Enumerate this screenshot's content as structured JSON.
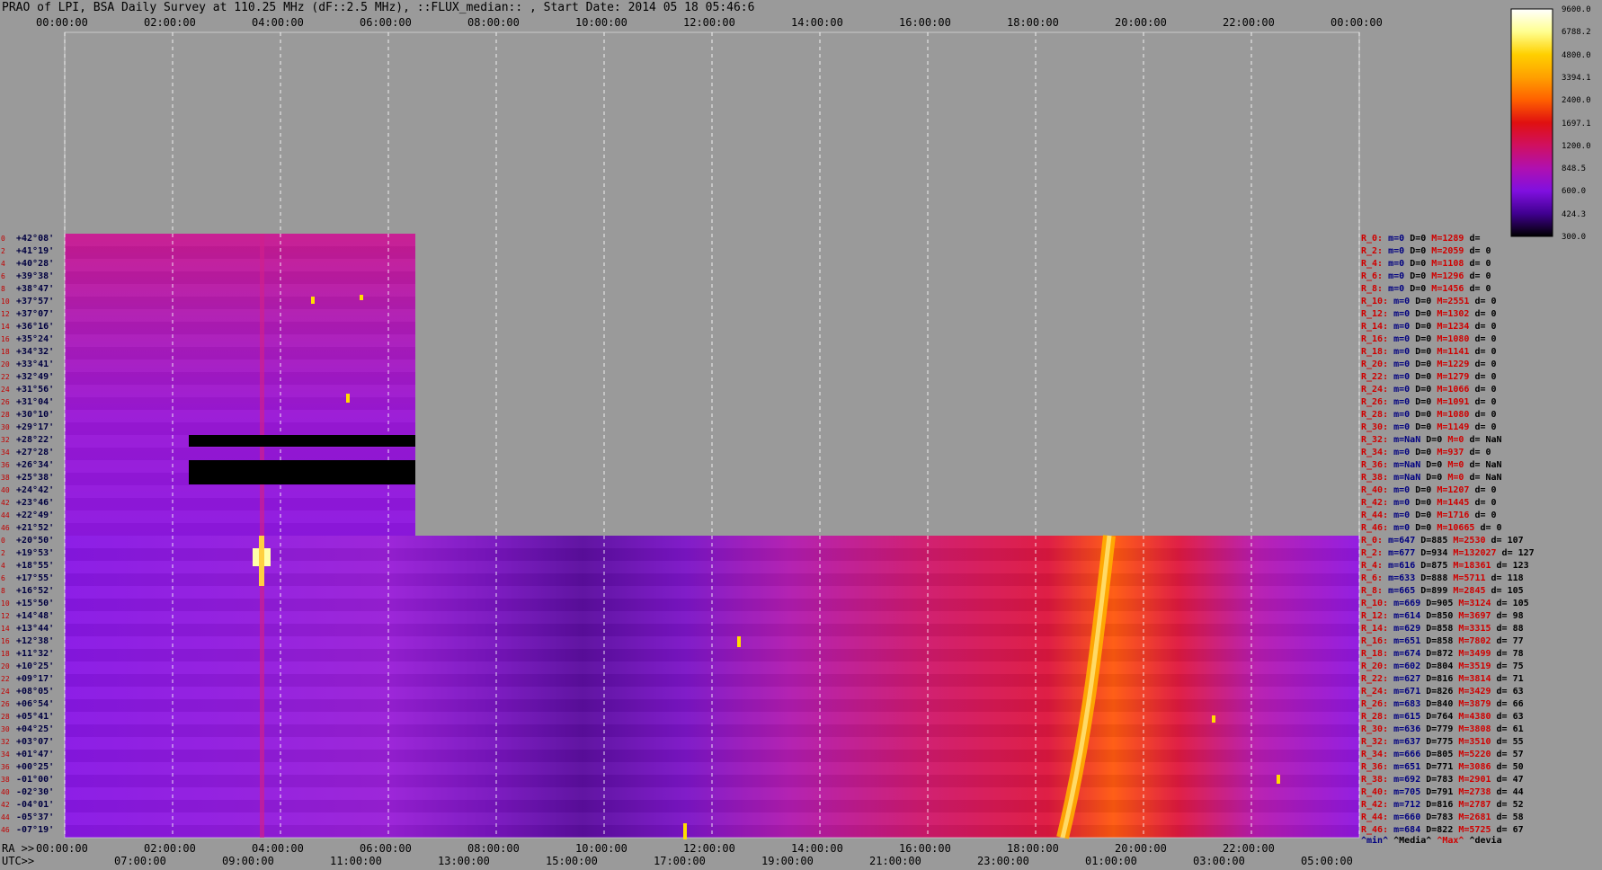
{
  "title": "PRAO of LPI, BSA Daily Survey at 110.25 MHz (dF::2.5 MHz), ::FLUX_median:: , Start Date: 2014 05 18 05:46:6",
  "bottom_axis": {
    "ra_prefix": "RA >>",
    "utc_prefix": "UTC>>"
  },
  "colorbar": {
    "tick_labels": [
      "9600.0",
      "6788.2",
      "4800.0",
      "3394.1",
      "2400.0",
      "1697.1",
      "1200.0",
      "848.5",
      "600.0",
      "424.3",
      "300.0"
    ],
    "colors": [
      "#ffffff",
      "#ffff90",
      "#ffd000",
      "#ffa000",
      "#ff6000",
      "#e01010",
      "#d01060",
      "#b010b0",
      "#8010e0",
      "#400090",
      "#000000"
    ]
  },
  "stats_footer": {
    "min": "^min^",
    "media": "^Media^",
    "max": "^Max^",
    "devia": "^devia"
  },
  "chart_data": {
    "type": "heatmap",
    "title": "PRAO of LPI, BSA Daily Survey at 110.25 MHz (dF::2.5 MHz), ::FLUX_median:: , Start Date: 2014 05 18 05:46:6",
    "x_top_ticks": [
      "00:00:00",
      "02:00:00",
      "04:00:00",
      "06:00:00",
      "08:00:00",
      "10:00:00",
      "12:00:00",
      "14:00:00",
      "16:00:00",
      "18:00:00",
      "20:00:00",
      "22:00:00",
      "00:00:00"
    ],
    "x_ra_ticks": [
      "00:00:00",
      "02:00:00",
      "04:00:00",
      "06:00:00",
      "08:00:00",
      "10:00:00",
      "12:00:00",
      "14:00:00",
      "16:00:00",
      "18:00:00",
      "20:00:00",
      "22:00:00"
    ],
    "x_utc_ticks": [
      "07:00:00",
      "09:00:00",
      "11:00:00",
      "13:00:00",
      "15:00:00",
      "17:00:00",
      "19:00:00",
      "21:00:00",
      "23:00:00",
      "01:00:00",
      "03:00:00",
      "05:00:00"
    ],
    "colorbar_scale": "log",
    "colorbar_range": [
      300.0,
      9600.0
    ],
    "upper_block": {
      "ra_range": [
        "00:00:00",
        "06:30:00"
      ],
      "rows": [
        {
          "idx": "0",
          "dec": "+42°08'",
          "stat": {
            "name": "R_0:",
            "m": "m=0",
            "D": "D=0",
            "M": "M=1289",
            "d": "d="
          }
        },
        {
          "idx": "2",
          "dec": "+41°19'",
          "stat": {
            "name": "R_2:",
            "m": "m=0",
            "D": "D=0",
            "M": "M=2059",
            "d": "d= 0"
          }
        },
        {
          "idx": "4",
          "dec": "+40°28'",
          "stat": {
            "name": "R_4:",
            "m": "m=0",
            "D": "D=0",
            "M": "M=1108",
            "d": "d= 0"
          }
        },
        {
          "idx": "6",
          "dec": "+39°38'",
          "stat": {
            "name": "R_6:",
            "m": "m=0",
            "D": "D=0",
            "M": "M=1296",
            "d": "d= 0"
          }
        },
        {
          "idx": "8",
          "dec": "+38°47'",
          "stat": {
            "name": "R_8:",
            "m": "m=0",
            "D": "D=0",
            "M": "M=1456",
            "d": "d= 0"
          }
        },
        {
          "idx": "10",
          "dec": "+37°57'",
          "stat": {
            "name": "R_10:",
            "m": "m=0",
            "D": "D=0",
            "M": "M=2551",
            "d": "d= 0"
          }
        },
        {
          "idx": "12",
          "dec": "+37°07'",
          "stat": {
            "name": "R_12:",
            "m": "m=0",
            "D": "D=0",
            "M": "M=1302",
            "d": "d= 0"
          }
        },
        {
          "idx": "14",
          "dec": "+36°16'",
          "stat": {
            "name": "R_14:",
            "m": "m=0",
            "D": "D=0",
            "M": "M=1234",
            "d": "d= 0"
          }
        },
        {
          "idx": "16",
          "dec": "+35°24'",
          "stat": {
            "name": "R_16:",
            "m": "m=0",
            "D": "D=0",
            "M": "M=1080",
            "d": "d= 0"
          }
        },
        {
          "idx": "18",
          "dec": "+34°32'",
          "stat": {
            "name": "R_18:",
            "m": "m=0",
            "D": "D=0",
            "M": "M=1141",
            "d": "d= 0"
          }
        },
        {
          "idx": "20",
          "dec": "+33°41'",
          "stat": {
            "name": "R_20:",
            "m": "m=0",
            "D": "D=0",
            "M": "M=1229",
            "d": "d= 0"
          }
        },
        {
          "idx": "22",
          "dec": "+32°49'",
          "stat": {
            "name": "R_22:",
            "m": "m=0",
            "D": "D=0",
            "M": "M=1279",
            "d": "d= 0"
          }
        },
        {
          "idx": "24",
          "dec": "+31°56'",
          "stat": {
            "name": "R_24:",
            "m": "m=0",
            "D": "D=0",
            "M": "M=1066",
            "d": "d= 0"
          }
        },
        {
          "idx": "26",
          "dec": "+31°04'",
          "stat": {
            "name": "R_26:",
            "m": "m=0",
            "D": "D=0",
            "M": "M=1091",
            "d": "d= 0"
          }
        },
        {
          "idx": "28",
          "dec": "+30°10'",
          "stat": {
            "name": "R_28:",
            "m": "m=0",
            "D": "D=0",
            "M": "M=1080",
            "d": "d= 0"
          }
        },
        {
          "idx": "30",
          "dec": "+29°17'",
          "stat": {
            "name": "R_30:",
            "m": "m=0",
            "D": "D=0",
            "M": "M=1149",
            "d": "d= 0"
          }
        },
        {
          "idx": "32",
          "dec": "+28°22'",
          "stat": {
            "name": "R_32:",
            "m": "m=NaN",
            "D": "D=0",
            "M": "M=0",
            "d": "d= NaN"
          }
        },
        {
          "idx": "34",
          "dec": "+27°28'",
          "stat": {
            "name": "R_34:",
            "m": "m=0",
            "D": "D=0",
            "M": "M=937",
            "d": "d= 0"
          }
        },
        {
          "idx": "36",
          "dec": "+26°34'",
          "stat": {
            "name": "R_36:",
            "m": "m=NaN",
            "D": "D=0",
            "M": "M=0",
            "d": "d= NaN"
          }
        },
        {
          "idx": "38",
          "dec": "+25°38'",
          "stat": {
            "name": "R_38:",
            "m": "m=NaN",
            "D": "D=0",
            "M": "M=0",
            "d": "d= NaN"
          }
        },
        {
          "idx": "40",
          "dec": "+24°42'",
          "stat": {
            "name": "R_40:",
            "m": "m=0",
            "D": "D=0",
            "M": "M=1207",
            "d": "d= 0"
          }
        },
        {
          "idx": "42",
          "dec": "+23°46'",
          "stat": {
            "name": "R_42:",
            "m": "m=0",
            "D": "D=0",
            "M": "M=1445",
            "d": "d= 0"
          }
        },
        {
          "idx": "44",
          "dec": "+22°49'",
          "stat": {
            "name": "R_44:",
            "m": "m=0",
            "D": "D=0",
            "M": "M=1716",
            "d": "d= 0"
          }
        },
        {
          "idx": "46",
          "dec": "+21°52'",
          "stat": {
            "name": "R_46:",
            "m": "m=0",
            "D": "D=0",
            "M": "M=10665",
            "d": "d= 0"
          }
        }
      ]
    },
    "lower_block": {
      "ra_range": [
        "00:00:00",
        "24:00:00"
      ],
      "rows": [
        {
          "idx": "0",
          "dec": "+20°50'",
          "stat": {
            "name": "R_0:",
            "m": "m=647",
            "D": "D=885",
            "M": "M=2530",
            "d": "d= 107"
          }
        },
        {
          "idx": "2",
          "dec": "+19°53'",
          "stat": {
            "name": "R_2:",
            "m": "m=677",
            "D": "D=934",
            "M": "M=132027",
            "d": "d= 127"
          }
        },
        {
          "idx": "4",
          "dec": "+18°55'",
          "stat": {
            "name": "R_4:",
            "m": "m=616",
            "D": "D=875",
            "M": "M=18361",
            "d": "d= 123"
          }
        },
        {
          "idx": "6",
          "dec": "+17°55'",
          "stat": {
            "name": "R_6:",
            "m": "m=633",
            "D": "D=888",
            "M": "M=5711",
            "d": "d= 118"
          }
        },
        {
          "idx": "8",
          "dec": "+16°52'",
          "stat": {
            "name": "R_8:",
            "m": "m=665",
            "D": "D=899",
            "M": "M=2845",
            "d": "d= 105"
          }
        },
        {
          "idx": "10",
          "dec": "+15°50'",
          "stat": {
            "name": "R_10:",
            "m": "m=669",
            "D": "D=905",
            "M": "M=3124",
            "d": "d= 105"
          }
        },
        {
          "idx": "12",
          "dec": "+14°48'",
          "stat": {
            "name": "R_12:",
            "m": "m=614",
            "D": "D=850",
            "M": "M=3697",
            "d": "d= 98"
          }
        },
        {
          "idx": "14",
          "dec": "+13°44'",
          "stat": {
            "name": "R_14:",
            "m": "m=629",
            "D": "D=858",
            "M": "M=3315",
            "d": "d= 88"
          }
        },
        {
          "idx": "16",
          "dec": "+12°38'",
          "stat": {
            "name": "R_16:",
            "m": "m=651",
            "D": "D=858",
            "M": "M=7802",
            "d": "d= 77"
          }
        },
        {
          "idx": "18",
          "dec": "+11°32'",
          "stat": {
            "name": "R_18:",
            "m": "m=674",
            "D": "D=872",
            "M": "M=3499",
            "d": "d= 78"
          }
        },
        {
          "idx": "20",
          "dec": "+10°25'",
          "stat": {
            "name": "R_20:",
            "m": "m=602",
            "D": "D=804",
            "M": "M=3519",
            "d": "d= 75"
          }
        },
        {
          "idx": "22",
          "dec": "+09°17'",
          "stat": {
            "name": "R_22:",
            "m": "m=627",
            "D": "D=816",
            "M": "M=3814",
            "d": "d= 71"
          }
        },
        {
          "idx": "24",
          "dec": "+08°05'",
          "stat": {
            "name": "R_24:",
            "m": "m=671",
            "D": "D=826",
            "M": "M=3429",
            "d": "d= 63"
          }
        },
        {
          "idx": "26",
          "dec": "+06°54'",
          "stat": {
            "name": "R_26:",
            "m": "m=683",
            "D": "D=840",
            "M": "M=3879",
            "d": "d= 66"
          }
        },
        {
          "idx": "28",
          "dec": "+05°41'",
          "stat": {
            "name": "R_28:",
            "m": "m=615",
            "D": "D=764",
            "M": "M=4380",
            "d": "d= 63"
          }
        },
        {
          "idx": "30",
          "dec": "+04°25'",
          "stat": {
            "name": "R_30:",
            "m": "m=636",
            "D": "D=779",
            "M": "M=3808",
            "d": "d= 61"
          }
        },
        {
          "idx": "32",
          "dec": "+03°07'",
          "stat": {
            "name": "R_32:",
            "m": "m=637",
            "D": "D=775",
            "M": "M=3510",
            "d": "d= 55"
          }
        },
        {
          "idx": "34",
          "dec": "+01°47'",
          "stat": {
            "name": "R_34:",
            "m": "m=666",
            "D": "D=805",
            "M": "M=5220",
            "d": "d= 57"
          }
        },
        {
          "idx": "36",
          "dec": "+00°25'",
          "stat": {
            "name": "R_36:",
            "m": "m=651",
            "D": "D=771",
            "M": "M=3086",
            "d": "d= 50"
          }
        },
        {
          "idx": "38",
          "dec": "-01°00'",
          "stat": {
            "name": "R_38:",
            "m": "m=692",
            "D": "D=783",
            "M": "M=2901",
            "d": "d= 47"
          }
        },
        {
          "idx": "40",
          "dec": "-02°30'",
          "stat": {
            "name": "R_40:",
            "m": "m=705",
            "D": "D=791",
            "M": "M=2738",
            "d": "d= 44"
          }
        },
        {
          "idx": "42",
          "dec": "-04°01'",
          "stat": {
            "name": "R_42:",
            "m": "m=712",
            "D": "D=816",
            "M": "M=2787",
            "d": "d= 52"
          }
        },
        {
          "idx": "44",
          "dec": "-05°37'",
          "stat": {
            "name": "R_44:",
            "m": "m=660",
            "D": "D=783",
            "M": "M=2681",
            "d": "d= 58"
          }
        },
        {
          "idx": "46",
          "dec": "-07°19'",
          "stat": {
            "name": "R_46:",
            "m": "m=684",
            "D": "D=822",
            "M": "M=5725",
            "d": "d= 67"
          }
        }
      ]
    },
    "flagged_rows_upper": [
      "R_32:",
      "R_36:",
      "R_38:"
    ],
    "grid": true
  }
}
